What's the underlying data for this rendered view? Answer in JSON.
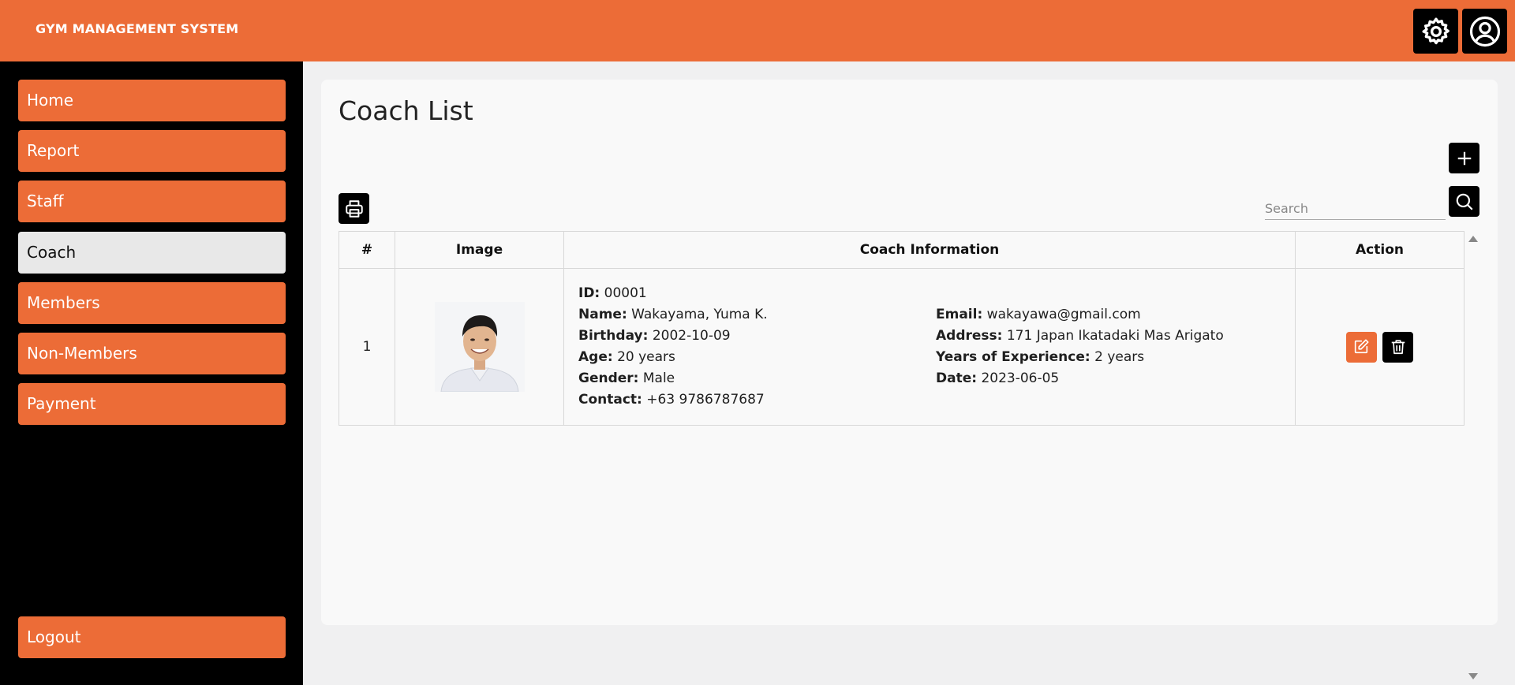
{
  "header": {
    "brand": "GYM MANAGEMENT SYSTEM",
    "accent_color": "#ec6c37",
    "icons": [
      "gear-icon",
      "user-circle-icon"
    ]
  },
  "sidebar": {
    "items": [
      {
        "label": "Home"
      },
      {
        "label": "Report"
      },
      {
        "label": "Staff"
      },
      {
        "label": "Coach",
        "active": true
      },
      {
        "label": "Members"
      },
      {
        "label": "Non-Members"
      },
      {
        "label": "Payment"
      }
    ],
    "logout_label": "Logout"
  },
  "main": {
    "title": "Coach List",
    "search": {
      "placeholder": "Search",
      "value": ""
    },
    "icons": [
      "plus-icon",
      "search-icon",
      "printer-icon"
    ],
    "table": {
      "headers": [
        "#",
        "Image",
        "Coach Information",
        "Action"
      ],
      "rows": [
        {
          "num": "1",
          "image_alt": "Coach photo",
          "left": [
            {
              "label": "ID:",
              "value": "00001"
            },
            {
              "label": "Name:",
              "value": "Wakayama, Yuma K."
            },
            {
              "label": "Birthday:",
              "value": "2002-10-09"
            },
            {
              "label": "Age:",
              "value": "20 years"
            },
            {
              "label": "Gender:",
              "value": "Male"
            },
            {
              "label": "Contact:",
              "value": "+63 9786787687"
            }
          ],
          "right": [
            {
              "label": "Email:",
              "value": "wakayawa@gmail.com"
            },
            {
              "label": "Address:",
              "value": "171 Japan Ikatadaki Mas Arigato"
            },
            {
              "label": "Years of Experience:",
              "value": "2 years"
            },
            {
              "label": "Date:",
              "value": "2023-06-05"
            }
          ],
          "action_icons": [
            "edit-icon",
            "trash-icon"
          ]
        }
      ]
    }
  }
}
